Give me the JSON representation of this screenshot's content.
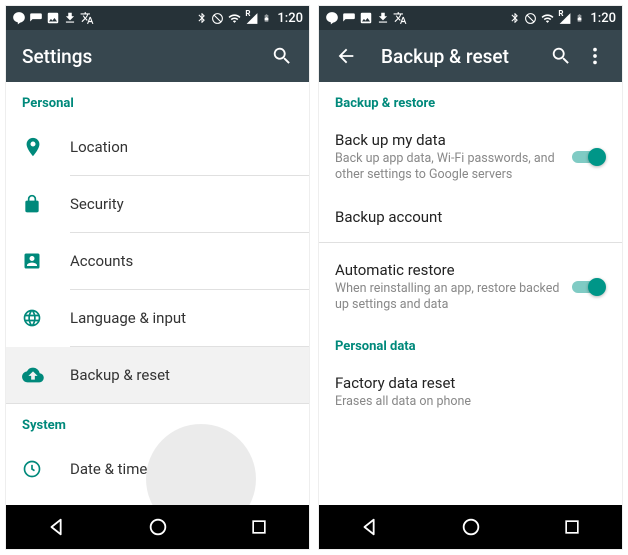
{
  "status": {
    "time": "1:20",
    "network_indicator": "R"
  },
  "left": {
    "title": "Settings",
    "section_personal": "Personal",
    "section_system": "System",
    "items": {
      "location": "Location",
      "security": "Security",
      "accounts": "Accounts",
      "language": "Language & input",
      "backup": "Backup & reset",
      "datetime": "Date & time"
    }
  },
  "right": {
    "title": "Backup & reset",
    "section_backup": "Backup & restore",
    "section_personal_data": "Personal data",
    "backup_data": {
      "title": "Back up my data",
      "summary": "Back up app data, Wi-Fi passwords, and other settings to Google servers"
    },
    "backup_account": {
      "title": "Backup account"
    },
    "auto_restore": {
      "title": "Automatic restore",
      "summary": "When reinstalling an app, restore backed up settings and data"
    },
    "factory_reset": {
      "title": "Factory data reset",
      "summary": "Erases all data on phone"
    }
  }
}
